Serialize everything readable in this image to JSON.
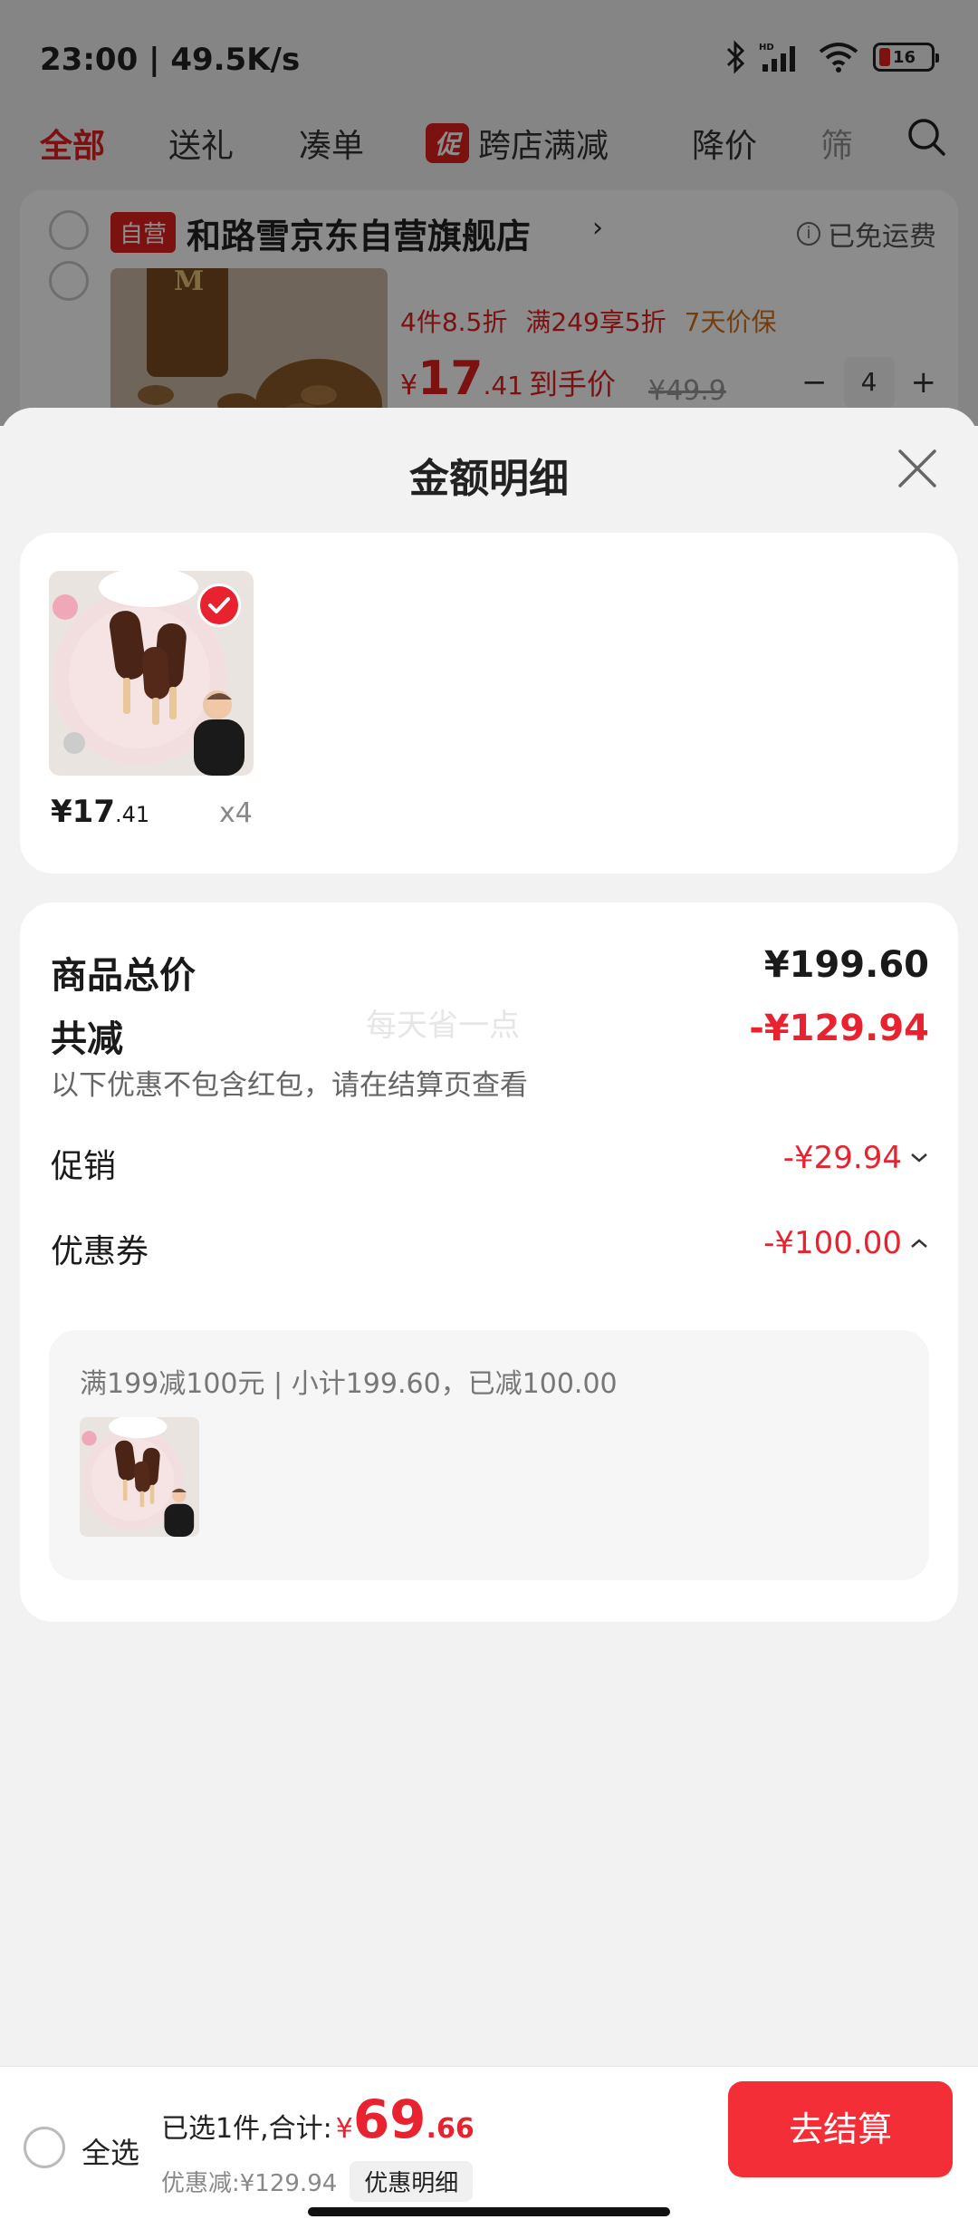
{
  "status_bar": {
    "time": "23:00 | 49.5K/s",
    "battery": "16"
  },
  "filter_tabs": {
    "items": [
      "全部",
      "送礼",
      "凑单",
      "跨店满减",
      "降价",
      "筛"
    ],
    "promo_badge": "促"
  },
  "store": {
    "badge": "自营",
    "name": "和路雪京东自营旗舰店",
    "arrow": "›",
    "shipping": "已免运费",
    "promos": [
      "4件8.5折",
      "满249享5折",
      "7天价保"
    ],
    "price_yen": "¥",
    "price_int": "17",
    "price_dec": ".41",
    "price_label": "到手价",
    "original_price": "¥49.9",
    "quantity": "4",
    "minus": "−",
    "plus": "+"
  },
  "sheet": {
    "title": "金额明细",
    "item": {
      "price_int": "¥17",
      "price_dec": ".41",
      "quantity": "x4"
    },
    "total_label": "商品总价",
    "total_value": "¥199.60",
    "reduction_label": "共减",
    "reduction_value": "-¥129.94",
    "reduction_note": "以下优惠不包含红包，请在结算页查看",
    "watermark": "每天省一点",
    "promotion_label": "促销",
    "promotion_value": "-¥29.94",
    "coupon_label": "优惠券",
    "coupon_value": "-¥100.00",
    "coupon_detail": "满199减100元 | 小计199.60，已减100.00"
  },
  "bottom_bar": {
    "select_all": "全选",
    "selected_label": "已选1件,合计:",
    "total_yen": "¥",
    "total_int": "69",
    "total_dec": ".66",
    "discount": "优惠减:¥129.94",
    "detail_button": "优惠明细",
    "checkout": "去结算"
  },
  "colors": {
    "accent_red": "#e8232f",
    "checkout_red": "#f42e36",
    "promo_orange": "#d4701a"
  }
}
